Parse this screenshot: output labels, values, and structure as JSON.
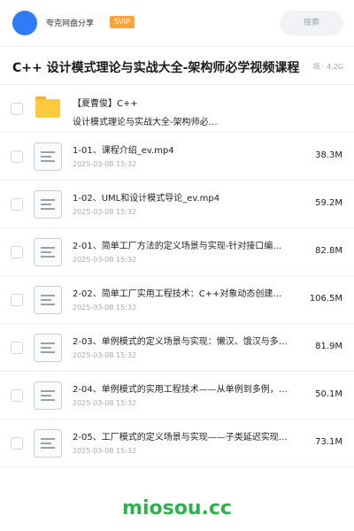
{
  "header": {
    "sharer_name": "夸克网盘分享",
    "badge": "SVIP",
    "search_placeholder": "搜索"
  },
  "title_bar": {
    "title": "C++ 设计模式理论与实战大全-架构师必学视频课程",
    "meta": "项 · 4.2G"
  },
  "folder": {
    "name_line1": "【夏曹俊】C++",
    "name_line2": "设计模式理论与实战大全-架构师必…",
    "icon": "folder-icon"
  },
  "files": [
    {
      "name": "1-01、课程介绍_ev.mp4",
      "date": "2025-03-08 15:32",
      "size": "38.3M"
    },
    {
      "name": "1-02、UML和设计模式导论_ev.mp4",
      "date": "2025-03-08 15:32",
      "size": "59.2M"
    },
    {
      "name": "2-01、简单工厂方法的定义场景与实现-针对接口编…",
      "date": "2025-03-08 15:32",
      "size": "82.8M"
    },
    {
      "name": "2-02、简单工厂实用工程技术：C++对象动态创建…",
      "date": "2025-03-08 15:32",
      "size": "106.5M"
    },
    {
      "name": "2-03、单例模式的定义场景与实现：懒汉、饿汉与多…",
      "date": "2025-03-08 15:32",
      "size": "81.9M"
    },
    {
      "name": "2-04、单例模式的实用工程技术——从单例到多例，…",
      "date": "2025-03-08 15:32",
      "size": "50.1M"
    },
    {
      "name": "2-05、工厂模式的定义场景与实现——子类延迟实现…",
      "date": "2025-03-08 15:32",
      "size": "73.1M"
    }
  ],
  "watermark": "miosou.cc",
  "colors": {
    "accent_blue": "#2f7cf6",
    "svip_orange": "#ffa23a",
    "folder_yellow": "#ffc93d",
    "watermark_green": "#2fb150"
  }
}
